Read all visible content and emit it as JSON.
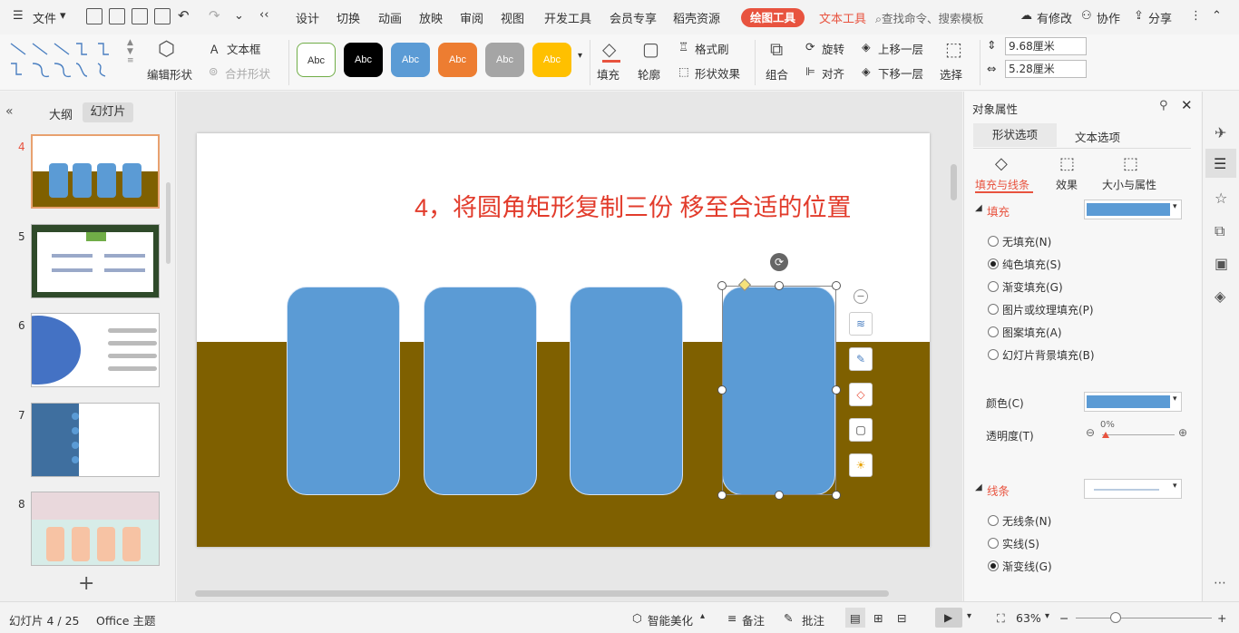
{
  "menubar": {
    "file": "文件",
    "tabs": [
      "设计",
      "切换",
      "动画",
      "放映",
      "审阅",
      "视图",
      "开发工具",
      "会员专享",
      "稻壳资源"
    ],
    "drawing_tools": "绘图工具",
    "text_tools": "文本工具",
    "search_placeholder": "查找命令、搜索模板",
    "modified": "有修改",
    "collab": "协作",
    "share": "分享"
  },
  "ribbon": {
    "edit_shape": "编辑形状",
    "textbox": "文本框",
    "merge_shape": "合并形状",
    "style_label": "Abc",
    "fill": "填充",
    "outline": "轮廓",
    "format_painter": "格式刷",
    "shape_effect": "形状效果",
    "group": "组合",
    "rotate": "旋转",
    "align": "对齐",
    "bring_forward": "上移一层",
    "send_backward": "下移一层",
    "select": "选择",
    "width_value": "9.68厘米",
    "height_value": "5.28厘米",
    "colors": {
      "accent_red": "#e8533f",
      "blue": "#5b9bd5",
      "orange": "#ed7d31",
      "gray": "#a5a5a5",
      "gold": "#ffc000"
    }
  },
  "leftpane": {
    "tab_outline": "大纲",
    "tab_slides": "幻灯片",
    "slides": [
      {
        "num": "4"
      },
      {
        "num": "5"
      },
      {
        "num": "6"
      },
      {
        "num": "7"
      },
      {
        "num": "8"
      }
    ]
  },
  "slide": {
    "title": "4，将圆角矩形复制三份 移至合适的位置",
    "brown": "#7f6000"
  },
  "rightpane": {
    "title": "对象属性",
    "tab_shape": "形状选项",
    "tab_text": "文本选项",
    "sub_fill_line": "填充与线条",
    "sub_effect": "效果",
    "sub_size": "大小与属性",
    "fill_section": "填充",
    "fill_options": [
      "无填充(N)",
      "纯色填充(S)",
      "渐变填充(G)",
      "图片或纹理填充(P)",
      "图案填充(A)",
      "幻灯片背景填充(B)"
    ],
    "fill_selected": 1,
    "color_label": "颜色(C)",
    "transparency_label": "透明度(T)",
    "transparency_value": "0%",
    "line_section": "线条",
    "line_options": [
      "无线条(N)",
      "实线(S)",
      "渐变线(G)"
    ],
    "line_selected": 2
  },
  "statusbar": {
    "slide_info": "幻灯片 4 / 25",
    "theme": "Office 主题",
    "smart_beautify": "智能美化",
    "notes": "备注",
    "comments": "批注",
    "zoom": "63%"
  }
}
